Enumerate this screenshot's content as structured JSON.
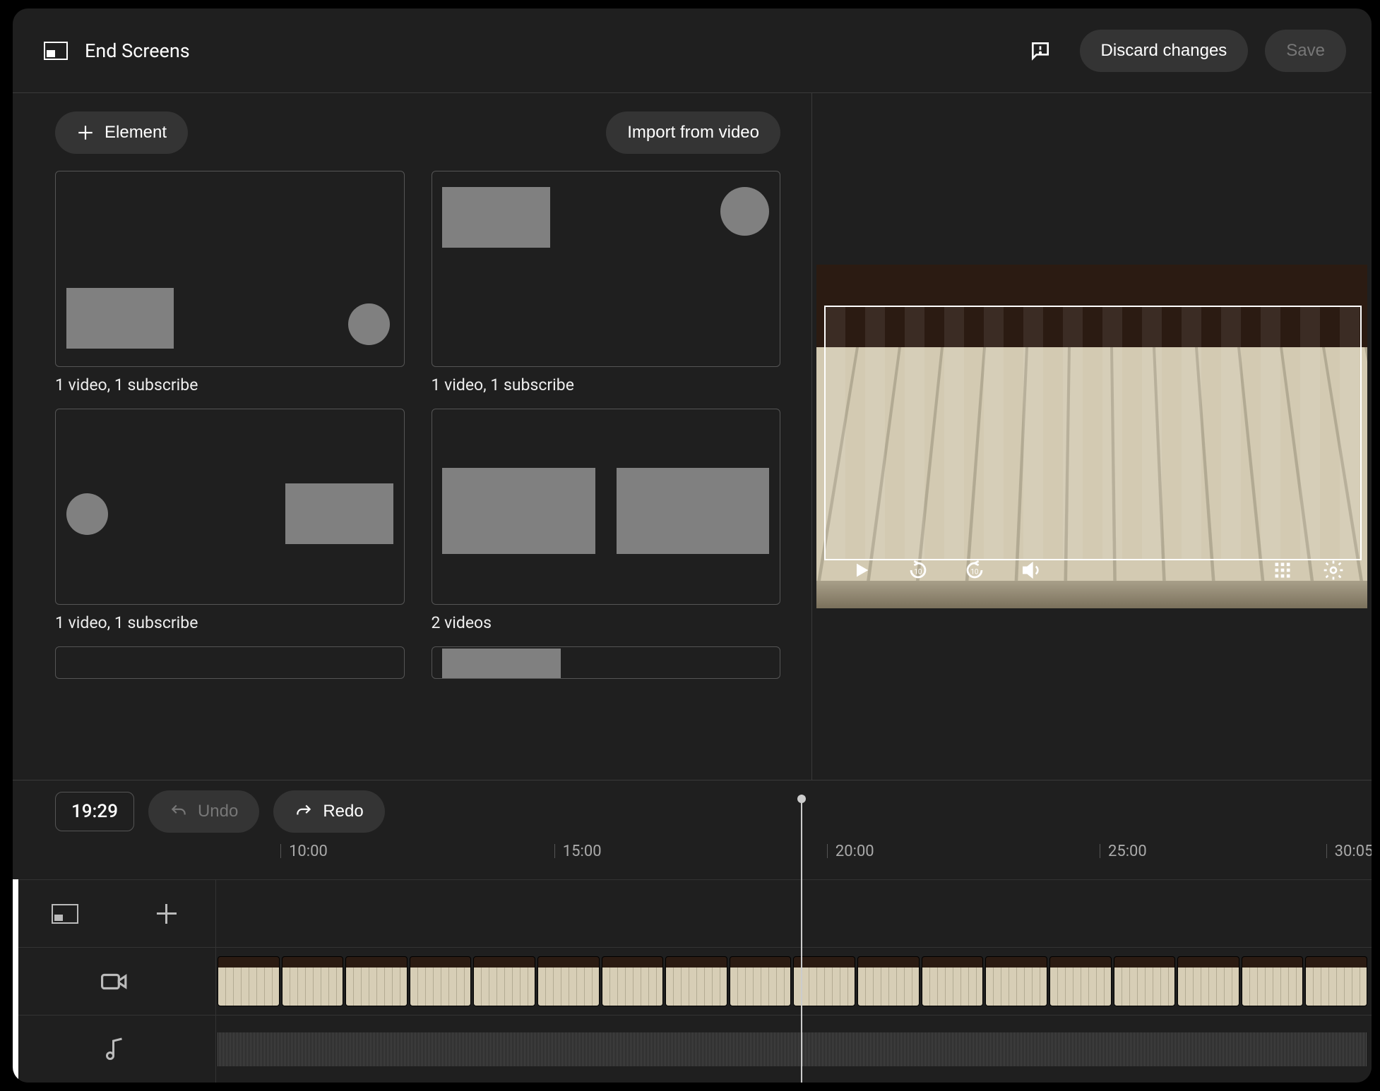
{
  "header": {
    "title": "End Screens",
    "discard_label": "Discard changes",
    "save_label": "Save"
  },
  "leftToolbar": {
    "element_label": "Element",
    "import_label": "Import from video"
  },
  "templates": [
    {
      "label": "1 video, 1 subscribe"
    },
    {
      "label": "1 video, 1 subscribe"
    },
    {
      "label": "1 video, 1 subscribe"
    },
    {
      "label": "2 videos"
    }
  ],
  "timeline": {
    "timecode": "19:29",
    "undo_label": "Undo",
    "redo_label": "Redo",
    "ticks": [
      "10:00",
      "15:00",
      "20:00",
      "25:00",
      "30:05"
    ]
  }
}
